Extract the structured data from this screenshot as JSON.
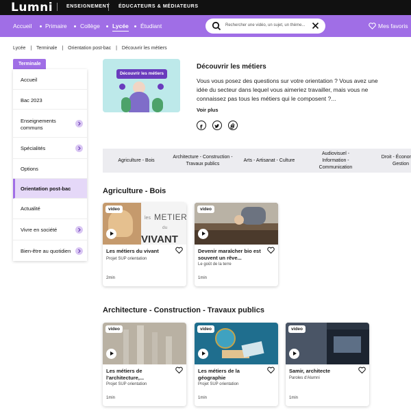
{
  "topbar": {
    "logo": "Lumni",
    "nav": [
      "ENSEIGNEMENT",
      "ÉDUCATEURS & MÉDIATEURS"
    ]
  },
  "levels": [
    "Accueil",
    "Primaire",
    "Collège",
    "Lycée",
    "Étudiant"
  ],
  "active_level": "Lycée",
  "search": {
    "placeholder": "Rechercher une vidéo, un sujet, un thème..."
  },
  "favorites": "Mes favoris",
  "breadcrumb": [
    "Lycée",
    "|",
    "Terminale",
    "|",
    "Orientation post-bac",
    "|",
    "Découvrir les métiers"
  ],
  "sidebar": {
    "tag": "Terminale",
    "items": [
      {
        "label": "Accueil",
        "chevron": false
      },
      {
        "label": "Bac 2023",
        "chevron": false
      },
      {
        "label": "Enseignements communs",
        "chevron": true
      },
      {
        "label": "Spécialités",
        "chevron": true
      },
      {
        "label": "Options",
        "chevron": false
      },
      {
        "label": "Orientation post-bac",
        "chevron": false,
        "active": true
      },
      {
        "label": "Actualité",
        "chevron": false
      },
      {
        "label": "Vivre en société",
        "chevron": true
      },
      {
        "label": "Bien-être au quotidien",
        "chevron": true
      }
    ]
  },
  "hero": {
    "image_title": "Découvrir les métiers",
    "title": "Découvrir les métiers",
    "description": "Vous vous posez des questions sur votre orientation ? Vous avez une idée du secteur dans lequel vous aimeriez travailler, mais vous ne connaissez pas tous les métiers qui le composent ?...",
    "more": "Voir plus",
    "share_icons": [
      "facebook-icon",
      "twitter-icon",
      "link-icon"
    ]
  },
  "categories": [
    "Agriculture - Bois",
    "Architecture - Construction - Travaux publics",
    "Arts - Artisanat - Culture",
    "Audiovisuel - Information - Communication",
    "Droit - Économie - Gestion"
  ],
  "sections": [
    {
      "title": "Agriculture - Bois",
      "cards": [
        {
          "badge": "video",
          "title": "Les métiers du vivant",
          "subtitle": "Projet SUP orientation",
          "duration": "2min",
          "thumb_text": [
            "les",
            "METIERS",
            "du",
            "VIVANT"
          ]
        },
        {
          "badge": "video",
          "title": "Devenir maraîcher bio est souvent un rêve...",
          "subtitle": "Le goût de la terre",
          "duration": "1min"
        }
      ]
    },
    {
      "title": "Architecture - Construction - Travaux publics",
      "cards": [
        {
          "badge": "video",
          "title": "Les métiers de l'architecture,...",
          "subtitle": "Projet SUP orientation",
          "duration": "1min"
        },
        {
          "badge": "video",
          "title": "Les métiers de la géographie",
          "subtitle": "Projet SUP orientation",
          "duration": "1min"
        },
        {
          "badge": "video",
          "title": "Samir, architecte",
          "subtitle": "Paroles d'Alumni",
          "duration": "1min"
        }
      ]
    }
  ]
}
